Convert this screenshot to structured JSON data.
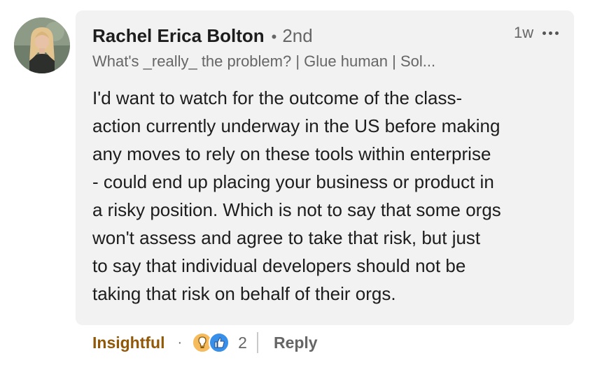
{
  "comment": {
    "author_name": "Rachel Erica Bolton",
    "separator": "•",
    "degree": "2nd",
    "headline": "What's _really_ the problem? | Glue human | Sol...",
    "timestamp": "1w",
    "more_icon": "ellipsis-icon",
    "avatar_icon": "profile-photo",
    "body_lines": [
      "I'd want to watch for the outcome of the class-",
      "action currently underway in the US before making",
      "any moves to rely on these tools within enterprise",
      "- could end up placing your business or product in",
      "a risky position. Which is not to say that some orgs",
      "won't assess and agree to take that risk, but just",
      "to say that individual developers should not be",
      "taking that risk on behalf of their orgs."
    ]
  },
  "actions": {
    "reaction_label": "Insightful",
    "dot": "·",
    "reaction_icons": [
      "insightful-icon",
      "like-icon"
    ],
    "reaction_count": "2",
    "reply_label": "Reply"
  },
  "colors": {
    "bubble_bg": "#f2f2f2",
    "insightful": "#915907",
    "secondary_text": "#666666",
    "like_blue": "#378fe9",
    "insightful_yellow": "#f5bb5c"
  }
}
